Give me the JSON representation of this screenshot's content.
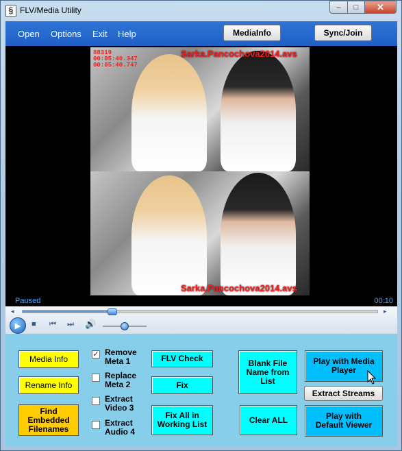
{
  "window": {
    "title": "FLV/Media Utility",
    "icon_glyph": "§"
  },
  "title_controls": {
    "minimize": "–",
    "maximize": "□",
    "close": "✕"
  },
  "menu": {
    "open": "Open",
    "options": "Options",
    "exit": "Exit",
    "help": "Help"
  },
  "header_buttons": {
    "mediainfo": "MediaInfo",
    "sync_join": "Sync/Join"
  },
  "video": {
    "overlay_filename_top": "Sarka.Pancochova2014.avs",
    "overlay_filename_bottom": "Sarka.Pancochova2014.avs",
    "overlay_line1": "88319",
    "overlay_line2": "00:05:40.347",
    "overlay_line3": "00:05:40.747"
  },
  "player": {
    "status": "Paused",
    "time": "00:10",
    "seek_progress": 0.25,
    "volume_level": 0.5
  },
  "buttons": {
    "media_info": "Media Info",
    "rename_info": "Rename Info",
    "find_embedded": "Find Embedded Filenames",
    "flv_check": "FLV Check",
    "fix": "Fix",
    "fix_all": "Fix All in Working List",
    "blank_file_name": "Blank File Name from List",
    "clear_all": "Clear ALL",
    "play_media_player": "Play with Media Player",
    "extract_streams": "Extract Streams",
    "play_default_viewer": "Play with Default Viewer"
  },
  "checkboxes": [
    {
      "label": "Remove Meta  1",
      "checked": true
    },
    {
      "label": "Replace Meta  2",
      "checked": false
    },
    {
      "label": "Extract Video 3",
      "checked": false
    },
    {
      "label": "Extract Audio 4",
      "checked": false
    }
  ],
  "colors": {
    "menubar": "#1f5fc6",
    "panel": "#87ceeb",
    "yellow_button": "#ffff00",
    "orange_button": "#ffcc00",
    "cyan_button": "#00ffff",
    "blue_button": "#00bfff",
    "overlay_red": "#ff1a1a"
  }
}
